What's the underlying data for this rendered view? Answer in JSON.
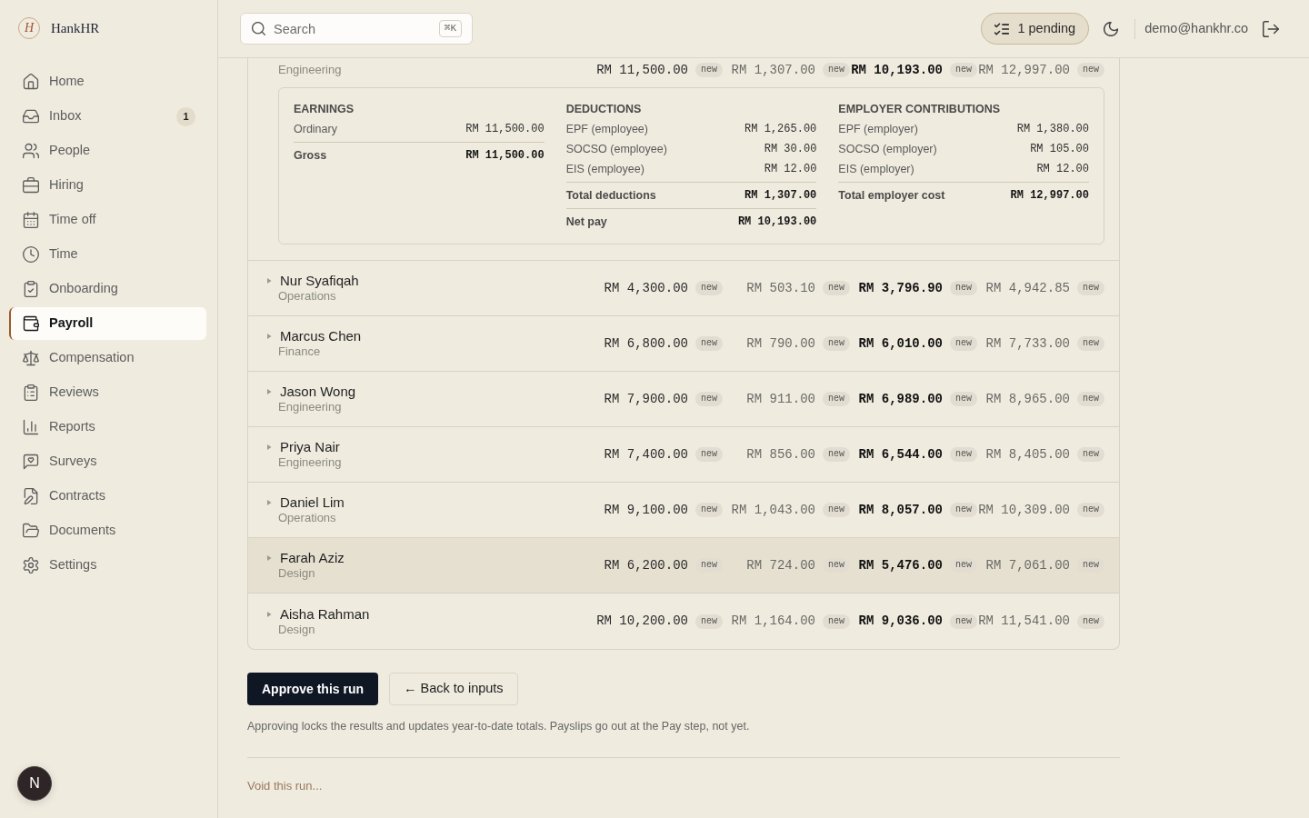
{
  "sidebar": {
    "brand": {
      "logo_letter": "H",
      "name": "HankHR"
    },
    "items": [
      {
        "label": "Home",
        "selected": false
      },
      {
        "label": "Inbox",
        "selected": false,
        "badge": "1"
      },
      {
        "label": "People",
        "selected": false
      },
      {
        "label": "Hiring",
        "selected": false
      },
      {
        "label": "Time off",
        "selected": false
      },
      {
        "label": "Time",
        "selected": false
      },
      {
        "label": "Onboarding",
        "selected": false
      },
      {
        "label": "Payroll",
        "selected": true
      },
      {
        "label": "Compensation",
        "selected": false
      },
      {
        "label": "Reviews",
        "selected": false
      },
      {
        "label": "Reports",
        "selected": false
      },
      {
        "label": "Surveys",
        "selected": false
      },
      {
        "label": "Contracts",
        "selected": false
      },
      {
        "label": "Documents",
        "selected": false
      },
      {
        "label": "Settings",
        "selected": false
      }
    ],
    "dev_button": {
      "label": "N"
    }
  },
  "header": {
    "search": {
      "placeholder": "Search",
      "shortcut": "⌘K"
    },
    "pending_button": {
      "label": "1 pending"
    },
    "user_email": "demo@hankhr.co"
  },
  "payroll_rows": [
    {
      "department": "Engineering",
      "expanded": true,
      "highlighted": false,
      "amounts": [
        {
          "value": "RM 11,500.00",
          "badge": "new"
        },
        {
          "value": "RM 1,307.00",
          "badge": "new"
        },
        {
          "value": "RM 10,193.00",
          "badge": "new"
        },
        {
          "value": "RM 12,997.00",
          "badge": "new"
        }
      ],
      "details": [
        {
          "title": "EARNINGS",
          "lines": [
            {
              "label": "Ordinary",
              "value": "RM 11,500.00"
            }
          ],
          "totals": [
            {
              "label": "Gross",
              "value": "RM 11,500.00"
            }
          ]
        },
        {
          "title": "DEDUCTIONS",
          "lines": [
            {
              "label": "EPF (employee)",
              "value": "RM 1,265.00"
            },
            {
              "label": "SOCSO (employee)",
              "value": "RM 30.00"
            },
            {
              "label": "EIS (employee)",
              "value": "RM 12.00"
            }
          ],
          "totals": [
            {
              "label": "Total deductions",
              "value": "RM 1,307.00"
            },
            {
              "label": "Net pay",
              "value": "RM 10,193.00"
            }
          ]
        },
        {
          "title": "EMPLOYER CONTRIBUTIONS",
          "lines": [
            {
              "label": "EPF (employer)",
              "value": "RM 1,380.00"
            },
            {
              "label": "SOCSO (employer)",
              "value": "RM 105.00"
            },
            {
              "label": "EIS (employer)",
              "value": "RM 12.00"
            }
          ],
          "totals": [
            {
              "label": "Total employer cost",
              "value": "RM 12,997.00"
            }
          ]
        }
      ]
    },
    {
      "name": "Nur Syafiqah",
      "department": "Operations",
      "expanded": false,
      "highlighted": false,
      "amounts": [
        {
          "value": "RM 4,300.00",
          "badge": "new"
        },
        {
          "value": "RM 503.10",
          "badge": "new"
        },
        {
          "value": "RM 3,796.90",
          "badge": "new"
        },
        {
          "value": "RM 4,942.85",
          "badge": "new"
        }
      ]
    },
    {
      "name": "Marcus Chen",
      "department": "Finance",
      "expanded": false,
      "highlighted": false,
      "amounts": [
        {
          "value": "RM 6,800.00",
          "badge": "new"
        },
        {
          "value": "RM 790.00",
          "badge": "new"
        },
        {
          "value": "RM 6,010.00",
          "badge": "new"
        },
        {
          "value": "RM 7,733.00",
          "badge": "new"
        }
      ]
    },
    {
      "name": "Jason Wong",
      "department": "Engineering",
      "expanded": false,
      "highlighted": false,
      "amounts": [
        {
          "value": "RM 7,900.00",
          "badge": "new"
        },
        {
          "value": "RM 911.00",
          "badge": "new"
        },
        {
          "value": "RM 6,989.00",
          "badge": "new"
        },
        {
          "value": "RM 8,965.00",
          "badge": "new"
        }
      ]
    },
    {
      "name": "Priya Nair",
      "department": "Engineering",
      "expanded": false,
      "highlighted": false,
      "amounts": [
        {
          "value": "RM 7,400.00",
          "badge": "new"
        },
        {
          "value": "RM 856.00",
          "badge": "new"
        },
        {
          "value": "RM 6,544.00",
          "badge": "new"
        },
        {
          "value": "RM 8,405.00",
          "badge": "new"
        }
      ]
    },
    {
      "name": "Daniel Lim",
      "department": "Operations",
      "expanded": false,
      "highlighted": false,
      "amounts": [
        {
          "value": "RM 9,100.00",
          "badge": "new"
        },
        {
          "value": "RM 1,043.00",
          "badge": "new"
        },
        {
          "value": "RM 8,057.00",
          "badge": "new"
        },
        {
          "value": "RM 10,309.00",
          "badge": "new"
        }
      ]
    },
    {
      "name": "Farah Aziz",
      "department": "Design",
      "expanded": false,
      "highlighted": true,
      "amounts": [
        {
          "value": "RM 6,200.00",
          "badge": "new"
        },
        {
          "value": "RM 724.00",
          "badge": "new"
        },
        {
          "value": "RM 5,476.00",
          "badge": "new"
        },
        {
          "value": "RM 7,061.00",
          "badge": "new"
        }
      ]
    },
    {
      "name": "Aisha Rahman",
      "department": "Design",
      "expanded": false,
      "highlighted": false,
      "amounts": [
        {
          "value": "RM 10,200.00",
          "badge": "new"
        },
        {
          "value": "RM 1,164.00",
          "badge": "new"
        },
        {
          "value": "RM 9,036.00",
          "badge": "new"
        },
        {
          "value": "RM 11,541.00",
          "badge": "new"
        }
      ]
    }
  ],
  "actions": {
    "approve_button": "Approve this run",
    "back_button": "← Back to inputs",
    "note": "Approving locks the results and updates year-to-date totals. Payslips go out at the Pay step, not yet.",
    "void_link": "Void this run..."
  }
}
